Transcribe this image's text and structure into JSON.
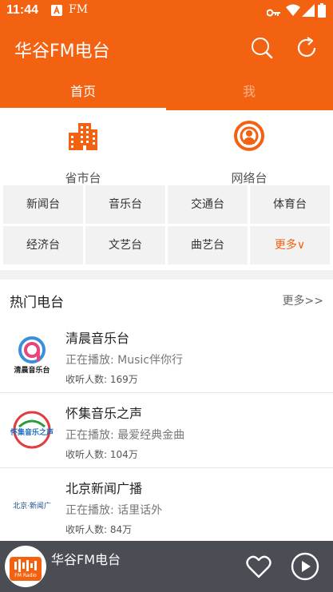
{
  "status_bar": {
    "time": "11:44",
    "fm_label": "FM"
  },
  "app_bar": {
    "title": "华谷FM电台",
    "search_icon": "search-icon",
    "refresh_icon": "refresh-icon"
  },
  "tabs": [
    {
      "label": "首页",
      "active": true
    },
    {
      "label": "我",
      "active": false
    }
  ],
  "categories": [
    {
      "label": "省市台",
      "icon": "buildings-icon"
    },
    {
      "label": "网络台",
      "icon": "podcast-icon"
    }
  ],
  "genres": [
    {
      "label": "新闻台"
    },
    {
      "label": "音乐台"
    },
    {
      "label": "交通台"
    },
    {
      "label": "体育台"
    },
    {
      "label": "经济台"
    },
    {
      "label": "文艺台"
    },
    {
      "label": "曲艺台"
    },
    {
      "label": "更多∨"
    }
  ],
  "hot": {
    "title": "热门电台",
    "more_label": "更多>>",
    "items": [
      {
        "name": "清晨音乐台",
        "now_playing": "正在播放: Music伴你行",
        "listeners": "收听人数: 169万",
        "logo_text": "清晨音乐台"
      },
      {
        "name": "怀集音乐之声",
        "now_playing": "正在播放: 最爱经典金曲",
        "listeners": "收听人数: 104万",
        "logo_text": "怀集音乐之声"
      },
      {
        "name": "北京新闻广播",
        "now_playing": "正在播放: 话里话外",
        "listeners": "收听人数: 84万",
        "logo_text": "北京·新闻广"
      }
    ]
  },
  "player": {
    "title": "华谷FM电台",
    "art_text": "FM Radio"
  },
  "colors": {
    "accent": "#f36211",
    "player_bg": "#4b4d55"
  }
}
